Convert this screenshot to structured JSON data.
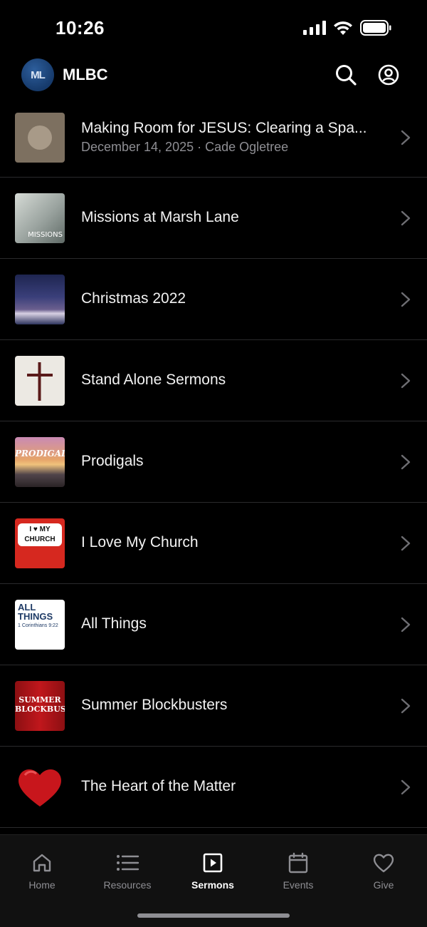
{
  "status_bar": {
    "time": "10:26"
  },
  "header": {
    "logo_text": "ML",
    "title": "MLBC"
  },
  "sermons": [
    {
      "title": "Making Room for JESUS: Clearing a Spa...",
      "subtitle": "December 14, 2025 · Cade Ogletree"
    },
    {
      "title": "Missions at Marsh Lane",
      "thumb_text": "MISSIONS"
    },
    {
      "title": "Christmas 2022"
    },
    {
      "title": "Stand Alone Sermons"
    },
    {
      "title": "Prodigals",
      "thumb_text": "PRODIGAL"
    },
    {
      "title": "I Love My Church",
      "thumb_text": "I ♥ MY CHURCH"
    },
    {
      "title": "All Things",
      "thumb_text": "ALL THINGS",
      "thumb_sub": "1 Corinthians 9:22"
    },
    {
      "title": "Summer Blockbusters",
      "thumb_text": "SUMMER BLOCKBUSTERS"
    },
    {
      "title": "The Heart of the Matter"
    }
  ],
  "tabs": [
    {
      "label": "Home",
      "icon": "home-icon",
      "active": false
    },
    {
      "label": "Resources",
      "icon": "list-icon",
      "active": false
    },
    {
      "label": "Sermons",
      "icon": "play-icon",
      "active": true
    },
    {
      "label": "Events",
      "icon": "calendar-icon",
      "active": false
    },
    {
      "label": "Give",
      "icon": "heart-icon",
      "active": false
    }
  ],
  "colors": {
    "background": "#000000",
    "text": "#ffffff",
    "secondary": "#8e8e93",
    "divider": "#2a2a2c"
  }
}
